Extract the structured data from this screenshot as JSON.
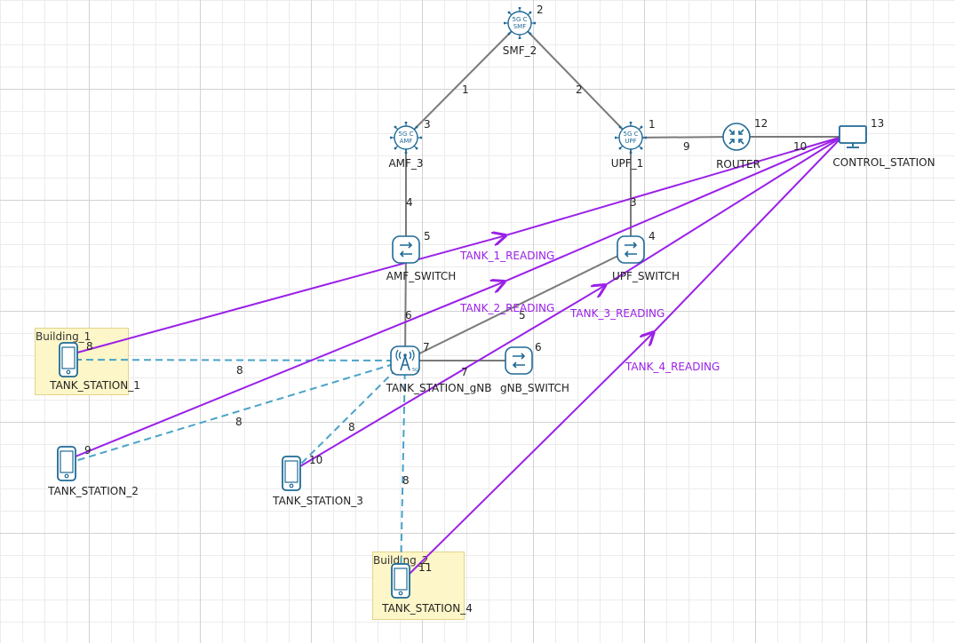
{
  "buildings": [
    {
      "id": "b1",
      "label": "Building_1"
    },
    {
      "id": "b2",
      "label": "Building_2"
    }
  ],
  "nodes": [
    {
      "id": "smf",
      "label": "SMF_2",
      "num": "2",
      "icon": "5gc-core",
      "text": "5G C\nSMF"
    },
    {
      "id": "amf",
      "label": "AMF_3",
      "num": "3",
      "icon": "5gc-core",
      "text": "5G C\nAMF"
    },
    {
      "id": "upf",
      "label": "UPF_1",
      "num": "1",
      "icon": "5gc-core",
      "text": "5G C\nUPF"
    },
    {
      "id": "router",
      "label": "ROUTER",
      "num": "12",
      "icon": "router"
    },
    {
      "id": "control",
      "label": "CONTROL_STATION",
      "num": "13",
      "icon": "monitor"
    },
    {
      "id": "amfsw",
      "label": "AMF_SWITCH",
      "num": "5",
      "icon": "switch"
    },
    {
      "id": "upfsw",
      "label": "UPF_SWITCH",
      "num": "4",
      "icon": "switch"
    },
    {
      "id": "gnb",
      "label": "TANK_STATION_gNB",
      "num": "7",
      "icon": "gnb-antenna"
    },
    {
      "id": "gnbsw",
      "label": "gNB_SWITCH",
      "num": "6",
      "icon": "switch"
    },
    {
      "id": "ts1",
      "label": "TANK_STATION_1",
      "num": "8",
      "icon": "phone"
    },
    {
      "id": "ts2",
      "label": "TANK_STATION_2",
      "num": "9",
      "icon": "phone"
    },
    {
      "id": "ts3",
      "label": "TANK_STATION_3",
      "num": "10",
      "icon": "phone"
    },
    {
      "id": "ts4",
      "label": "TANK_STATION_4",
      "num": "11",
      "icon": "phone"
    }
  ],
  "links": [
    {
      "from": "amf",
      "to": "smf",
      "label": "1",
      "kind": "wired"
    },
    {
      "from": "smf",
      "to": "upf",
      "label": "2",
      "kind": "wired"
    },
    {
      "from": "upf",
      "to": "upfsw",
      "label": "3",
      "kind": "wired"
    },
    {
      "from": "amf",
      "to": "amfsw",
      "label": "4",
      "kind": "wired"
    },
    {
      "from": "upfsw",
      "to": "gnb",
      "label": "5",
      "kind": "wired"
    },
    {
      "from": "amfsw",
      "to": "gnb",
      "label": "6",
      "kind": "wired"
    },
    {
      "from": "gnb",
      "to": "gnbsw",
      "label": "7",
      "kind": "wired"
    },
    {
      "from": "upf",
      "to": "router",
      "label": "9",
      "kind": "wired"
    },
    {
      "from": "router",
      "to": "control",
      "label": "10",
      "kind": "wired"
    },
    {
      "from": "gnb",
      "to": "ts1",
      "label": "8",
      "kind": "wireless"
    },
    {
      "from": "gnb",
      "to": "ts2",
      "label": "8",
      "kind": "wireless"
    },
    {
      "from": "gnb",
      "to": "ts3",
      "label": "8",
      "kind": "wireless"
    },
    {
      "from": "gnb",
      "to": "ts4",
      "label": "8",
      "kind": "wireless"
    }
  ],
  "packets": [
    {
      "from": "ts1",
      "to": "control",
      "label": "TANK_1_READING"
    },
    {
      "from": "ts2",
      "to": "control",
      "label": "TANK_2_READING"
    },
    {
      "from": "ts3",
      "to": "control",
      "label": "TANK_3_READING"
    },
    {
      "from": "ts4",
      "to": "control",
      "label": "TANK_4_READING"
    }
  ],
  "colors": {
    "wired": "#7a7a7a",
    "wireless": "#4aa3c8",
    "packet": "#9b20e8",
    "icon": "#1f6a96",
    "building_fill": "#fdf6c8"
  }
}
